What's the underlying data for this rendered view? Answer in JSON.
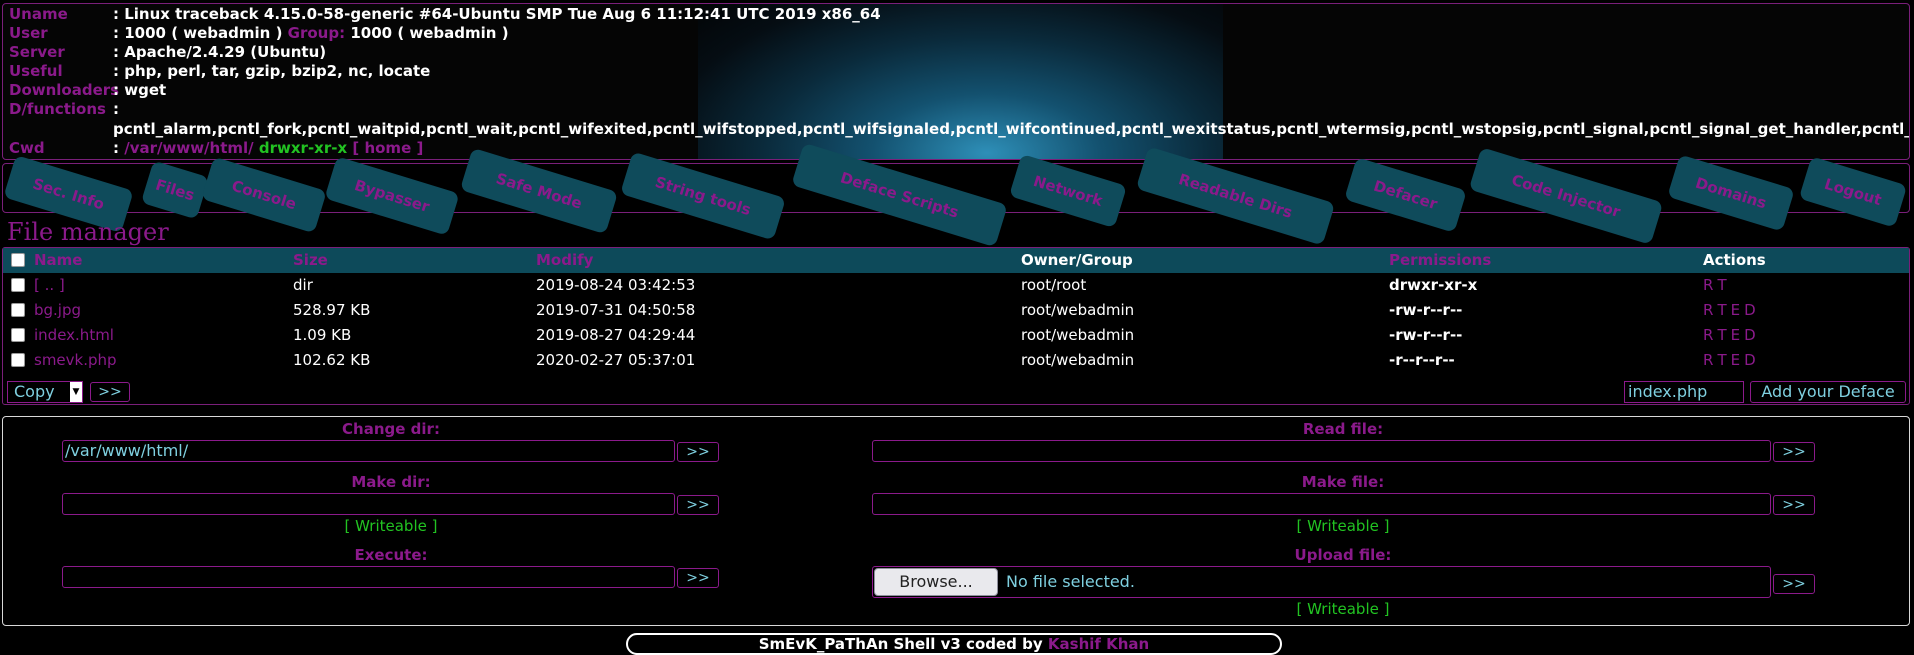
{
  "info": {
    "rows": [
      {
        "label": "Uname",
        "value": ": Linux traceback 4.15.0-58-generic #64-Ubuntu SMP Tue Aug 6 11:12:41 UTC 2019 x86_64"
      },
      {
        "label": "User",
        "value": ": 1000 ( webadmin )"
      },
      {
        "label": "Server",
        "value": ": Apache/2.4.29 (Ubuntu)"
      },
      {
        "label": "Useful",
        "value": ": php, perl, tar, gzip, bzip2, nc, locate"
      },
      {
        "label": "Downloaders",
        "value": ": wget"
      },
      {
        "label": "D/functions",
        "value": ":"
      },
      {
        "label": "",
        "value": "pcntl_alarm,pcntl_fork,pcntl_waitpid,pcntl_wait,pcntl_wifexited,pcntl_wifstopped,pcntl_wifsignaled,pcntl_wifcontinued,pcntl_wexitstatus,pcntl_wtermsig,pcntl_wstopsig,pcntl_signal,pcntl_signal_get_handler,pcntl_signal_disp"
      },
      {
        "label": "Cwd",
        "value": ": "
      }
    ],
    "group_label": "Group:",
    "group_value": "1000 ( webadmin )",
    "cwd_path": "/var/www/html/",
    "cwd_perms": "drwxr-xr-x",
    "cwd_home": "[ home ]"
  },
  "nav": [
    "Sec. Info",
    "Files",
    "Console",
    "Bypasser",
    "Safe Mode",
    "String tools",
    "Deface Scripts",
    "Network",
    "Readable Dirs",
    "Defacer",
    "Code Injector",
    "Domains",
    "Logout"
  ],
  "file_manager": {
    "title": "File manager",
    "columns": [
      "Name",
      "Size",
      "Modify",
      "Owner/Group",
      "Permissions",
      "Actions"
    ],
    "rows": [
      {
        "name": "[ .. ]",
        "size": "dir",
        "modify": "2019-08-24 03:42:53",
        "owner": "root/root",
        "perms": "drwxr-xr-x",
        "actions": [
          "R",
          "T"
        ]
      },
      {
        "name": "bg.jpg",
        "size": "528.97 KB",
        "modify": "2019-07-31 04:50:58",
        "owner": "root/webadmin",
        "perms": "-rw-r--r--",
        "actions": [
          "R",
          "T",
          "E",
          "D"
        ]
      },
      {
        "name": "index.html",
        "size": "1.09 KB",
        "modify": "2019-08-27 04:29:44",
        "owner": "root/webadmin",
        "perms": "-rw-r--r--",
        "actions": [
          "R",
          "T",
          "E",
          "D"
        ]
      },
      {
        "name": "smevk.php",
        "size": "102.62 KB",
        "modify": "2020-02-27 05:37:01",
        "owner": "root/webadmin",
        "perms": "-r--r--r--",
        "actions": [
          "R",
          "T",
          "E",
          "D"
        ]
      }
    ],
    "action_select": "Copy",
    "action_go": ">>",
    "deface_file": "index.php",
    "deface_button": "Add your Deface"
  },
  "tools": {
    "change_dir": {
      "label": "Change dir:",
      "value": "/var/www/html/",
      "go": ">>"
    },
    "read_file": {
      "label": "Read file:",
      "value": "",
      "go": ">>"
    },
    "make_dir": {
      "label": "Make dir:",
      "value": "",
      "go": ">>",
      "status": "[ Writeable ]"
    },
    "make_file": {
      "label": "Make file:",
      "value": "",
      "go": ">>",
      "status": "[ Writeable ]"
    },
    "execute": {
      "label": "Execute:",
      "value": "",
      "go": ">>"
    },
    "upload_file": {
      "label": "Upload file:",
      "browse": "Browse...",
      "no_file": "No file selected.",
      "go": ">>",
      "status": "[ Writeable ]"
    }
  },
  "footer": {
    "text": "SmEvK_PaThAn Shell v3 coded by",
    "author": "Kashif Khan"
  }
}
